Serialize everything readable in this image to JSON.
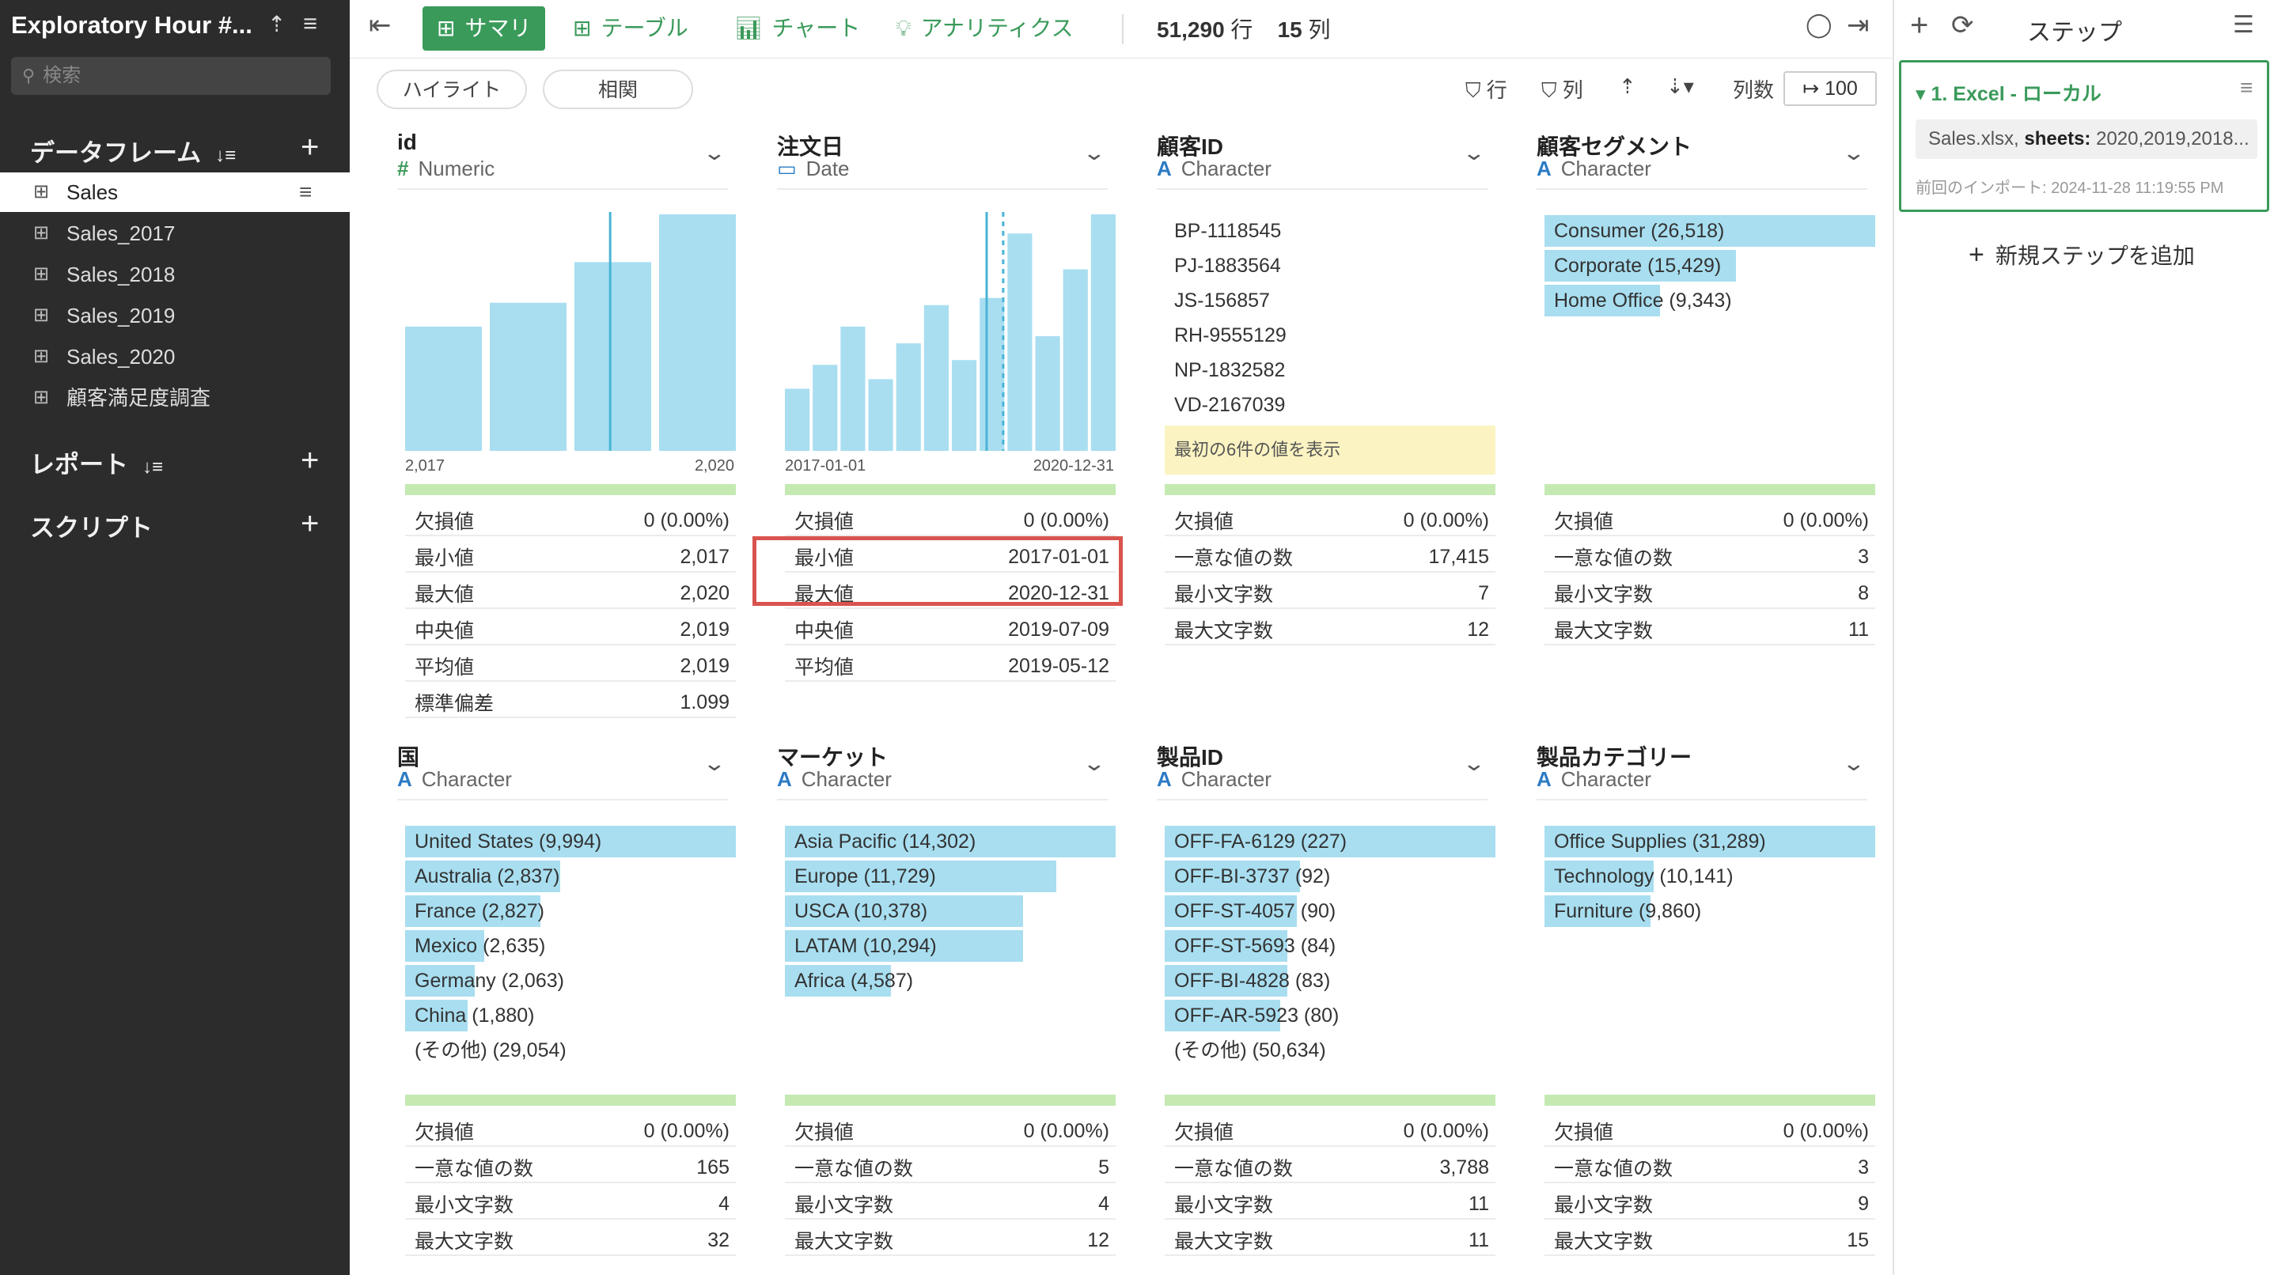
{
  "sidebar": {
    "title": "Exploratory Hour #...",
    "search_placeholder": "検索",
    "dataframes_label": "データフレーム",
    "reports_label": "レポート",
    "scripts_label": "スクリプト",
    "items": [
      {
        "label": "Sales",
        "active": true
      },
      {
        "label": "Sales_2017"
      },
      {
        "label": "Sales_2018"
      },
      {
        "label": "Sales_2019"
      },
      {
        "label": "Sales_2020"
      },
      {
        "label": "顧客満足度調査"
      }
    ]
  },
  "toolbar": {
    "summary": "サマリ",
    "table": "テーブル",
    "chart": "チャート",
    "analytics": "アナリティクス",
    "rows_count": "51,290",
    "rows_unit": "行",
    "cols_count": "15",
    "cols_unit": "列"
  },
  "subbar": {
    "highlight": "ハイライト",
    "correlation": "相関",
    "row_filter": "行",
    "col_filter": "列",
    "col_count_label": "列数",
    "col_count_value": "100"
  },
  "cards": [
    {
      "name": "id",
      "type": "Numeric",
      "chart": {
        "axis_min": "2,017",
        "axis_max": "2,020",
        "values": [
          0.52,
          0.62,
          0.79,
          0.99
        ],
        "marker": 0.62
      },
      "stats": [
        [
          "欠損値",
          "0 (0.00%)"
        ],
        [
          "最小値",
          "2,017"
        ],
        [
          "最大値",
          "2,020"
        ],
        [
          "中央値",
          "2,019"
        ],
        [
          "平均値",
          "2,019"
        ],
        [
          "標準偏差",
          "1.099"
        ]
      ]
    },
    {
      "name": "注文日",
      "type": "Date",
      "chart": {
        "axis_min": "2017-01-01",
        "axis_max": "2020-12-31",
        "values": [
          0.26,
          0.36,
          0.52,
          0.3,
          0.45,
          0.61,
          0.38,
          0.64,
          0.91,
          0.48,
          0.76,
          0.99
        ],
        "marker": 0.61,
        "marker2": 0.66
      },
      "stats": [
        [
          "欠損値",
          "0 (0.00%)"
        ],
        [
          "最小値",
          "2017-01-01"
        ],
        [
          "最大値",
          "2020-12-31"
        ],
        [
          "中央値",
          "2019-07-09"
        ],
        [
          "平均値",
          "2019-05-12"
        ]
      ]
    },
    {
      "name": "顧客ID",
      "type": "Character",
      "unique_values": [
        "BP-1118545",
        "PJ-1883564",
        "JS-156857",
        "RH-9555129",
        "NP-1832582",
        "VD-2167039"
      ],
      "note": "最初の6件の値を表示",
      "stats": [
        [
          "欠損値",
          "0 (0.00%)"
        ],
        [
          "一意な値の数",
          "17,415"
        ],
        [
          "最小文字数",
          "7"
        ],
        [
          "最大文字数",
          "12"
        ]
      ]
    },
    {
      "name": "顧客セグメント",
      "type": "Character",
      "values": [
        [
          "Consumer (26,518)",
          1.0
        ],
        [
          "Corporate (15,429)",
          0.58
        ],
        [
          "Home Office (9,343)",
          0.35
        ]
      ],
      "stats": [
        [
          "欠損値",
          "0 (0.00%)"
        ],
        [
          "一意な値の数",
          "3"
        ],
        [
          "最小文字数",
          "8"
        ],
        [
          "最大文字数",
          "11"
        ]
      ]
    },
    {
      "name": "国",
      "type": "Character",
      "values": [
        [
          "United States (9,994)",
          1.0
        ],
        [
          "Australia (2,837)",
          0.47
        ],
        [
          "France (2,827)",
          0.41
        ],
        [
          "Mexico (2,635)",
          0.24
        ],
        [
          "Germany (2,063)",
          0.21
        ],
        [
          "China (1,880)",
          0.19
        ],
        [
          "(その他) (29,054)",
          0
        ]
      ],
      "stats": [
        [
          "欠損値",
          "0 (0.00%)"
        ],
        [
          "一意な値の数",
          "165"
        ],
        [
          "最小文字数",
          "4"
        ],
        [
          "最大文字数",
          "32"
        ]
      ]
    },
    {
      "name": "マーケット",
      "type": "Character",
      "values": [
        [
          "Asia Pacific (14,302)",
          1.0
        ],
        [
          "Europe (11,729)",
          0.82
        ],
        [
          "USCA (10,378)",
          0.72
        ],
        [
          "LATAM (10,294)",
          0.72
        ],
        [
          "Africa (4,587)",
          0.32
        ]
      ],
      "stats": [
        [
          "欠損値",
          "0 (0.00%)"
        ],
        [
          "一意な値の数",
          "5"
        ],
        [
          "最小文字数",
          "4"
        ],
        [
          "最大文字数",
          "12"
        ]
      ]
    },
    {
      "name": "製品ID",
      "type": "Character",
      "values": [
        [
          "OFF-FA-6129 (227)",
          1.0
        ],
        [
          "OFF-BI-3737 (92)",
          0.41
        ],
        [
          "OFF-ST-4057 (90)",
          0.4
        ],
        [
          "OFF-ST-5693 (84)",
          0.37
        ],
        [
          "OFF-BI-4828 (83)",
          0.37
        ],
        [
          "OFF-AR-5923 (80)",
          0.35
        ],
        [
          "(その他) (50,634)",
          0
        ]
      ],
      "stats": [
        [
          "欠損値",
          "0 (0.00%)"
        ],
        [
          "一意な値の数",
          "3,788"
        ],
        [
          "最小文字数",
          "11"
        ],
        [
          "最大文字数",
          "11"
        ]
      ]
    },
    {
      "name": "製品カテゴリー",
      "type": "Character",
      "values": [
        [
          "Office Supplies (31,289)",
          1.0
        ],
        [
          "Technology (10,141)",
          0.33
        ],
        [
          "Furniture (9,860)",
          0.32
        ]
      ],
      "stats": [
        [
          "欠損値",
          "0 (0.00%)"
        ],
        [
          "一意な値の数",
          "3"
        ],
        [
          "最小文字数",
          "9"
        ],
        [
          "最大文字数",
          "15"
        ]
      ]
    }
  ],
  "steps": {
    "title": "ステップ",
    "step1_title": "1. Excel - ローカル",
    "step1_file": "Sales.xlsx,",
    "step1_sheets_label": "sheets:",
    "step1_sheets": "2020,2019,2018...",
    "step1_timestamp": "前回のインポート: 2024-11-28 11:19:55 PM",
    "add_step": "新規ステップを追加"
  },
  "colors": {
    "accent": "#3a9a5a",
    "bar": "#a8def0",
    "highlight_box": "#d9534f"
  }
}
